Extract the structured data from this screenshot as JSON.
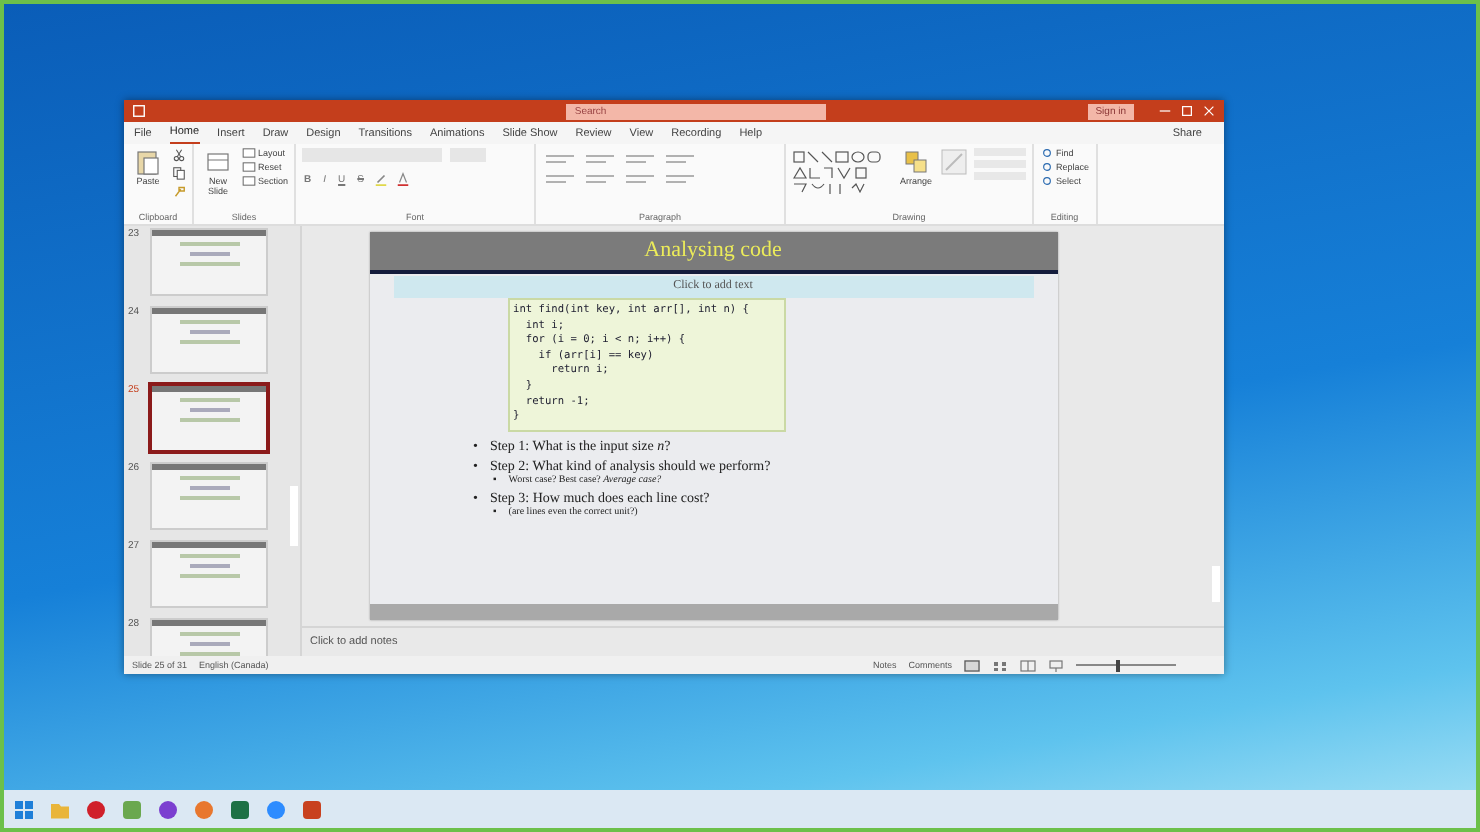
{
  "window": {
    "search": {
      "placeholder": "Search"
    },
    "sign_in": "Sign in"
  },
  "tabs": [
    {
      "label": "File",
      "selected": false
    },
    {
      "label": "Home",
      "selected": true
    },
    {
      "label": "Insert",
      "selected": false
    },
    {
      "label": "Draw",
      "selected": false
    },
    {
      "label": "Design",
      "selected": false
    },
    {
      "label": "Transitions",
      "selected": false
    },
    {
      "label": "Animations",
      "selected": false
    },
    {
      "label": "Slide Show",
      "selected": false
    },
    {
      "label": "Review",
      "selected": false
    },
    {
      "label": "View",
      "selected": false
    },
    {
      "label": "Recording",
      "selected": false
    },
    {
      "label": "Help",
      "selected": false
    }
  ],
  "share": "Share",
  "ribbon": {
    "clipboard": {
      "paste": "Paste",
      "label": "Clipboard"
    },
    "slides": {
      "new_slide": "New Slide",
      "small": [
        "Layout",
        "Reset",
        "Section"
      ],
      "label": "Slides"
    },
    "font": {
      "buttons": [
        "B",
        "I",
        "U",
        "S"
      ],
      "label": "Font"
    },
    "paragraph": {
      "label": "Paragraph"
    },
    "drawing": {
      "arrange": "Arrange",
      "label": "Drawing"
    },
    "editing": {
      "items": [
        "Find",
        "Replace",
        "Select"
      ],
      "label": "Editing"
    }
  },
  "thumbnails": [
    {
      "number": "23",
      "selected": false
    },
    {
      "number": "24",
      "selected": false
    },
    {
      "number": "25",
      "selected": true
    },
    {
      "number": "26",
      "selected": false
    },
    {
      "number": "27",
      "selected": false
    },
    {
      "number": "28",
      "selected": false
    }
  ],
  "slide": {
    "title": "Analysing code",
    "subtitle_placeholder": "Click to add text",
    "code": [
      "int find(int key, int arr[], int n) {",
      "  int i;",
      "  for (i = 0; i < n; i++) {",
      "    if (arr[i] == key)",
      "      return i;",
      "  }",
      "  return -1;",
      "}"
    ],
    "bullets": [
      {
        "marker": "•",
        "text": "Step 1: What is the input size *n*?"
      },
      {
        "marker": "•",
        "text": "Step 2: What kind of analysis should we perform?",
        "children": [
          {
            "marker": "▪",
            "text": "Worst case? Best case? *Average case?*"
          }
        ]
      },
      {
        "marker": "•",
        "text": "Step 3: How much does each line cost?",
        "children": [
          {
            "marker": "▪",
            "text": "(are lines even the correct unit?)"
          }
        ]
      }
    ]
  },
  "notes_placeholder": "Click to add notes",
  "status_bar": {
    "slide_count": "Slide 25 of 31",
    "language": "English (Canada)",
    "notes": "Notes",
    "comments": "Comments",
    "zoom": {
      "level": 0.4
    }
  },
  "taskbar": [
    {
      "kind": "start"
    },
    {
      "kind": "folder"
    },
    {
      "kind": "opera"
    },
    {
      "kind": "photos"
    },
    {
      "kind": "chat"
    },
    {
      "kind": "firefox"
    },
    {
      "kind": "excel"
    },
    {
      "kind": "zoom"
    },
    {
      "kind": "powerpoint"
    }
  ]
}
